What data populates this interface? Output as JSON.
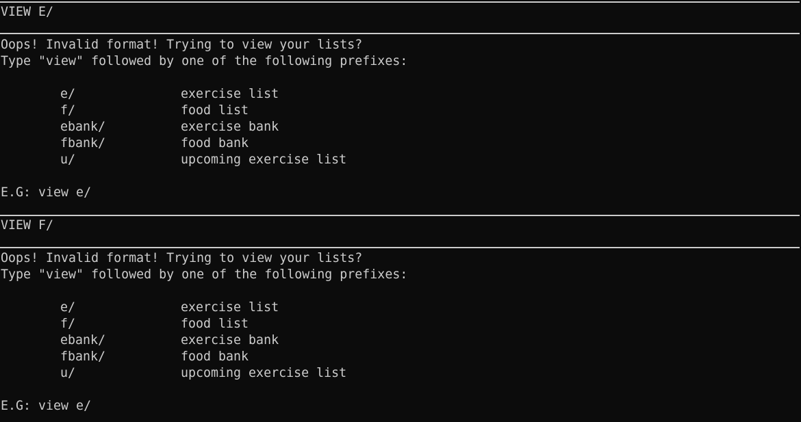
{
  "colors": {
    "background": "#0c0c0c",
    "foreground": "#cccccc"
  },
  "blocks": [
    {
      "command": "VIEW E/",
      "error": "Oops! Invalid format! Trying to view your lists?",
      "instruction": "Type \"view\" followed by one of the following prefixes:",
      "prefixes": [
        {
          "prefix": "e/",
          "description": "exercise list"
        },
        {
          "prefix": "f/",
          "description": "food list"
        },
        {
          "prefix": "ebank/",
          "description": "exercise bank"
        },
        {
          "prefix": "fbank/",
          "description": "food bank"
        },
        {
          "prefix": "u/",
          "description": "upcoming exercise list"
        }
      ],
      "example": "E.G: view e/"
    },
    {
      "command": "VIEW F/",
      "error": "Oops! Invalid format! Trying to view your lists?",
      "instruction": "Type \"view\" followed by one of the following prefixes:",
      "prefixes": [
        {
          "prefix": "e/",
          "description": "exercise list"
        },
        {
          "prefix": "f/",
          "description": "food list"
        },
        {
          "prefix": "ebank/",
          "description": "exercise bank"
        },
        {
          "prefix": "fbank/",
          "description": "food bank"
        },
        {
          "prefix": "u/",
          "description": "upcoming exercise list"
        }
      ],
      "example": "E.G: view e/"
    }
  ]
}
